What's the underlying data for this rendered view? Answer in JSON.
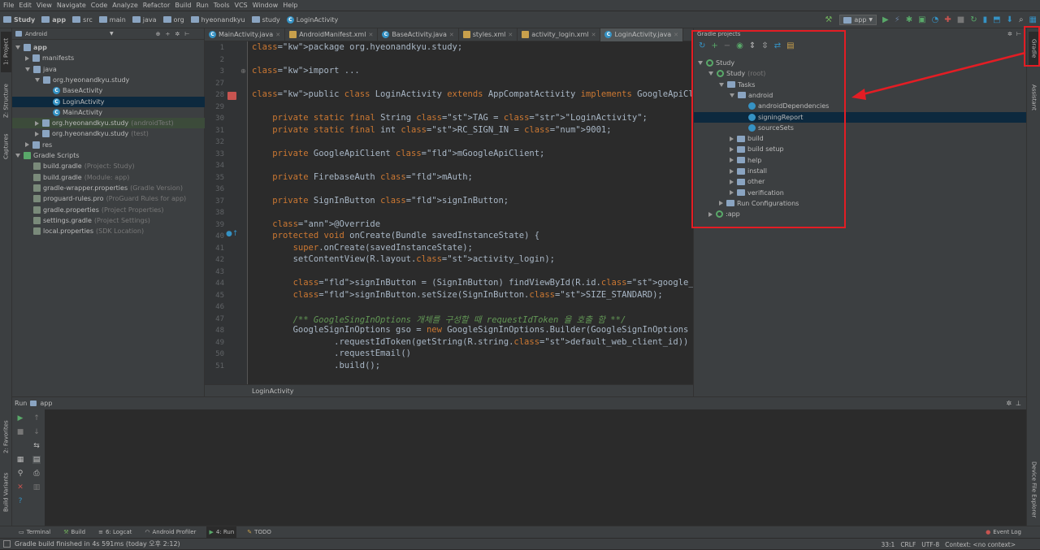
{
  "menu": [
    "File",
    "Edit",
    "View",
    "Navigate",
    "Code",
    "Analyze",
    "Refactor",
    "Build",
    "Run",
    "Tools",
    "VCS",
    "Window",
    "Help"
  ],
  "breadcrumbs": [
    "Study",
    "app",
    "src",
    "main",
    "java",
    "org",
    "hyeonandkyu",
    "study",
    "LoginActivity"
  ],
  "run_config": "app",
  "project_view": {
    "mode": "Android",
    "tree": [
      {
        "label": "app",
        "level": 0,
        "open": true
      },
      {
        "label": "manifests",
        "level": 1,
        "open": false
      },
      {
        "label": "java",
        "level": 1,
        "open": true
      },
      {
        "label": "org.hyeonandkyu.study",
        "level": 2,
        "open": true
      },
      {
        "label": "BaseActivity",
        "level": 3
      },
      {
        "label": "LoginActivity",
        "level": 3,
        "selected": true
      },
      {
        "label": "MainActivity",
        "level": 3
      },
      {
        "label": "org.hyeonandkyu.study",
        "suffix": "(androidTest)",
        "level": 2,
        "open": false
      },
      {
        "label": "org.hyeonandkyu.study",
        "suffix": "(test)",
        "level": 2,
        "open": false
      },
      {
        "label": "res",
        "level": 1,
        "open": false
      },
      {
        "label": "Gradle Scripts",
        "level": 0,
        "open": true
      },
      {
        "label": "build.gradle",
        "suffix": "(Project: Study)",
        "level": 1
      },
      {
        "label": "build.gradle",
        "suffix": "(Module: app)",
        "level": 1
      },
      {
        "label": "gradle-wrapper.properties",
        "suffix": "(Gradle Version)",
        "level": 1
      },
      {
        "label": "proguard-rules.pro",
        "suffix": "(ProGuard Rules for app)",
        "level": 1
      },
      {
        "label": "gradle.properties",
        "suffix": "(Project Properties)",
        "level": 1
      },
      {
        "label": "settings.gradle",
        "suffix": "(Project Settings)",
        "level": 1
      },
      {
        "label": "local.properties",
        "suffix": "(SDK Location)",
        "level": 1
      }
    ]
  },
  "left_tabs": [
    "1: Project",
    "Z: Structure",
    "Captures",
    "2: Favorites",
    "Build Variants"
  ],
  "editor_tabs": [
    "MainActivity.java",
    "AndroidManifest.xml",
    "BaseActivity.java",
    "styles.xml",
    "activity_login.xml",
    "LoginActivity.java"
  ],
  "active_tab": "LoginActivity.java",
  "line_numbers": [
    "1",
    "2",
    "3",
    "27",
    "28",
    "29",
    "30",
    "31",
    "32",
    "33",
    "34",
    "35",
    "36",
    "37",
    "38",
    "39",
    "40",
    "41",
    "42",
    "43",
    "44",
    "45",
    "46",
    "47",
    "48",
    "49",
    "50",
    "51"
  ],
  "code_lines": [
    "package org.hyeonandkyu.study;",
    "",
    "import ...",
    "",
    "public class LoginActivity extends AppCompatActivity implements GoogleApiClient.OnCo",
    "",
    "    private static final String TAG = \"LoginActivity\";",
    "    private static final int RC_SIGN_IN = 9001;",
    "",
    "    private GoogleApiClient mGoogleApiClient;",
    "",
    "    private FirebaseAuth mAuth;",
    "",
    "    private SignInButton signInButton;",
    "",
    "    @Override",
    "    protected void onCreate(Bundle savedInstanceState) {",
    "        super.onCreate(savedInstanceState);",
    "        setContentView(R.layout.activity_login);",
    "",
    "        signInButton = (SignInButton) findViewById(R.id.google_login);",
    "        signInButton.setSize(SignInButton.SIZE_STANDARD);",
    "",
    "        /** GoogleSingInOptions 개체를 구성할 때 requestIdToken 을 호출 함 **/",
    "        GoogleSignInOptions gso = new GoogleSignInOptions.Builder(GoogleSignInOptions",
    "                .requestIdToken(getString(R.string.default_web_client_id))",
    "                .requestEmail()",
    "                .build();"
  ],
  "editor_crumb": "LoginActivity",
  "gradle": {
    "title": "Gradle projects",
    "tree": [
      {
        "label": "Study",
        "level": 0,
        "type": "gradle"
      },
      {
        "label": "Study",
        "suffix": "(root)",
        "level": 1,
        "type": "gradle"
      },
      {
        "label": "Tasks",
        "level": 2,
        "type": "folder"
      },
      {
        "label": "android",
        "level": 3,
        "type": "folder"
      },
      {
        "label": "androidDependencies",
        "level": 4,
        "type": "task"
      },
      {
        "label": "signingReport",
        "level": 4,
        "type": "task",
        "selected": true
      },
      {
        "label": "sourceSets",
        "level": 4,
        "type": "task"
      },
      {
        "label": "build",
        "level": 3,
        "type": "folder"
      },
      {
        "label": "build setup",
        "level": 3,
        "type": "folder"
      },
      {
        "label": "help",
        "level": 3,
        "type": "folder"
      },
      {
        "label": "install",
        "level": 3,
        "type": "folder"
      },
      {
        "label": "other",
        "level": 3,
        "type": "folder"
      },
      {
        "label": "verification",
        "level": 3,
        "type": "folder"
      },
      {
        "label": "Run Configurations",
        "level": 2,
        "type": "folder"
      },
      {
        "label": ":app",
        "level": 1,
        "type": "gradle"
      }
    ]
  },
  "right_tabs": [
    "Gradle",
    "Assistant",
    "Device File Explorer"
  ],
  "run_panel": {
    "label": "Run",
    "config": "app"
  },
  "bottom_tabs": [
    "Terminal",
    "Build",
    "6: Logcat",
    "Android Profiler",
    "4: Run",
    "TODO"
  ],
  "event_log": "Event Log",
  "status": {
    "message": "Gradle build finished in 4s 591ms (today 오후 2:12)",
    "position": "33:1",
    "line_sep": "CRLF",
    "encoding": "UTF-8",
    "context": "Context: <no context>"
  },
  "colors": {
    "highlight": "#e31d24",
    "selection": "#0d293e",
    "background": "#2b2b2b",
    "panel": "#3c3f41"
  }
}
